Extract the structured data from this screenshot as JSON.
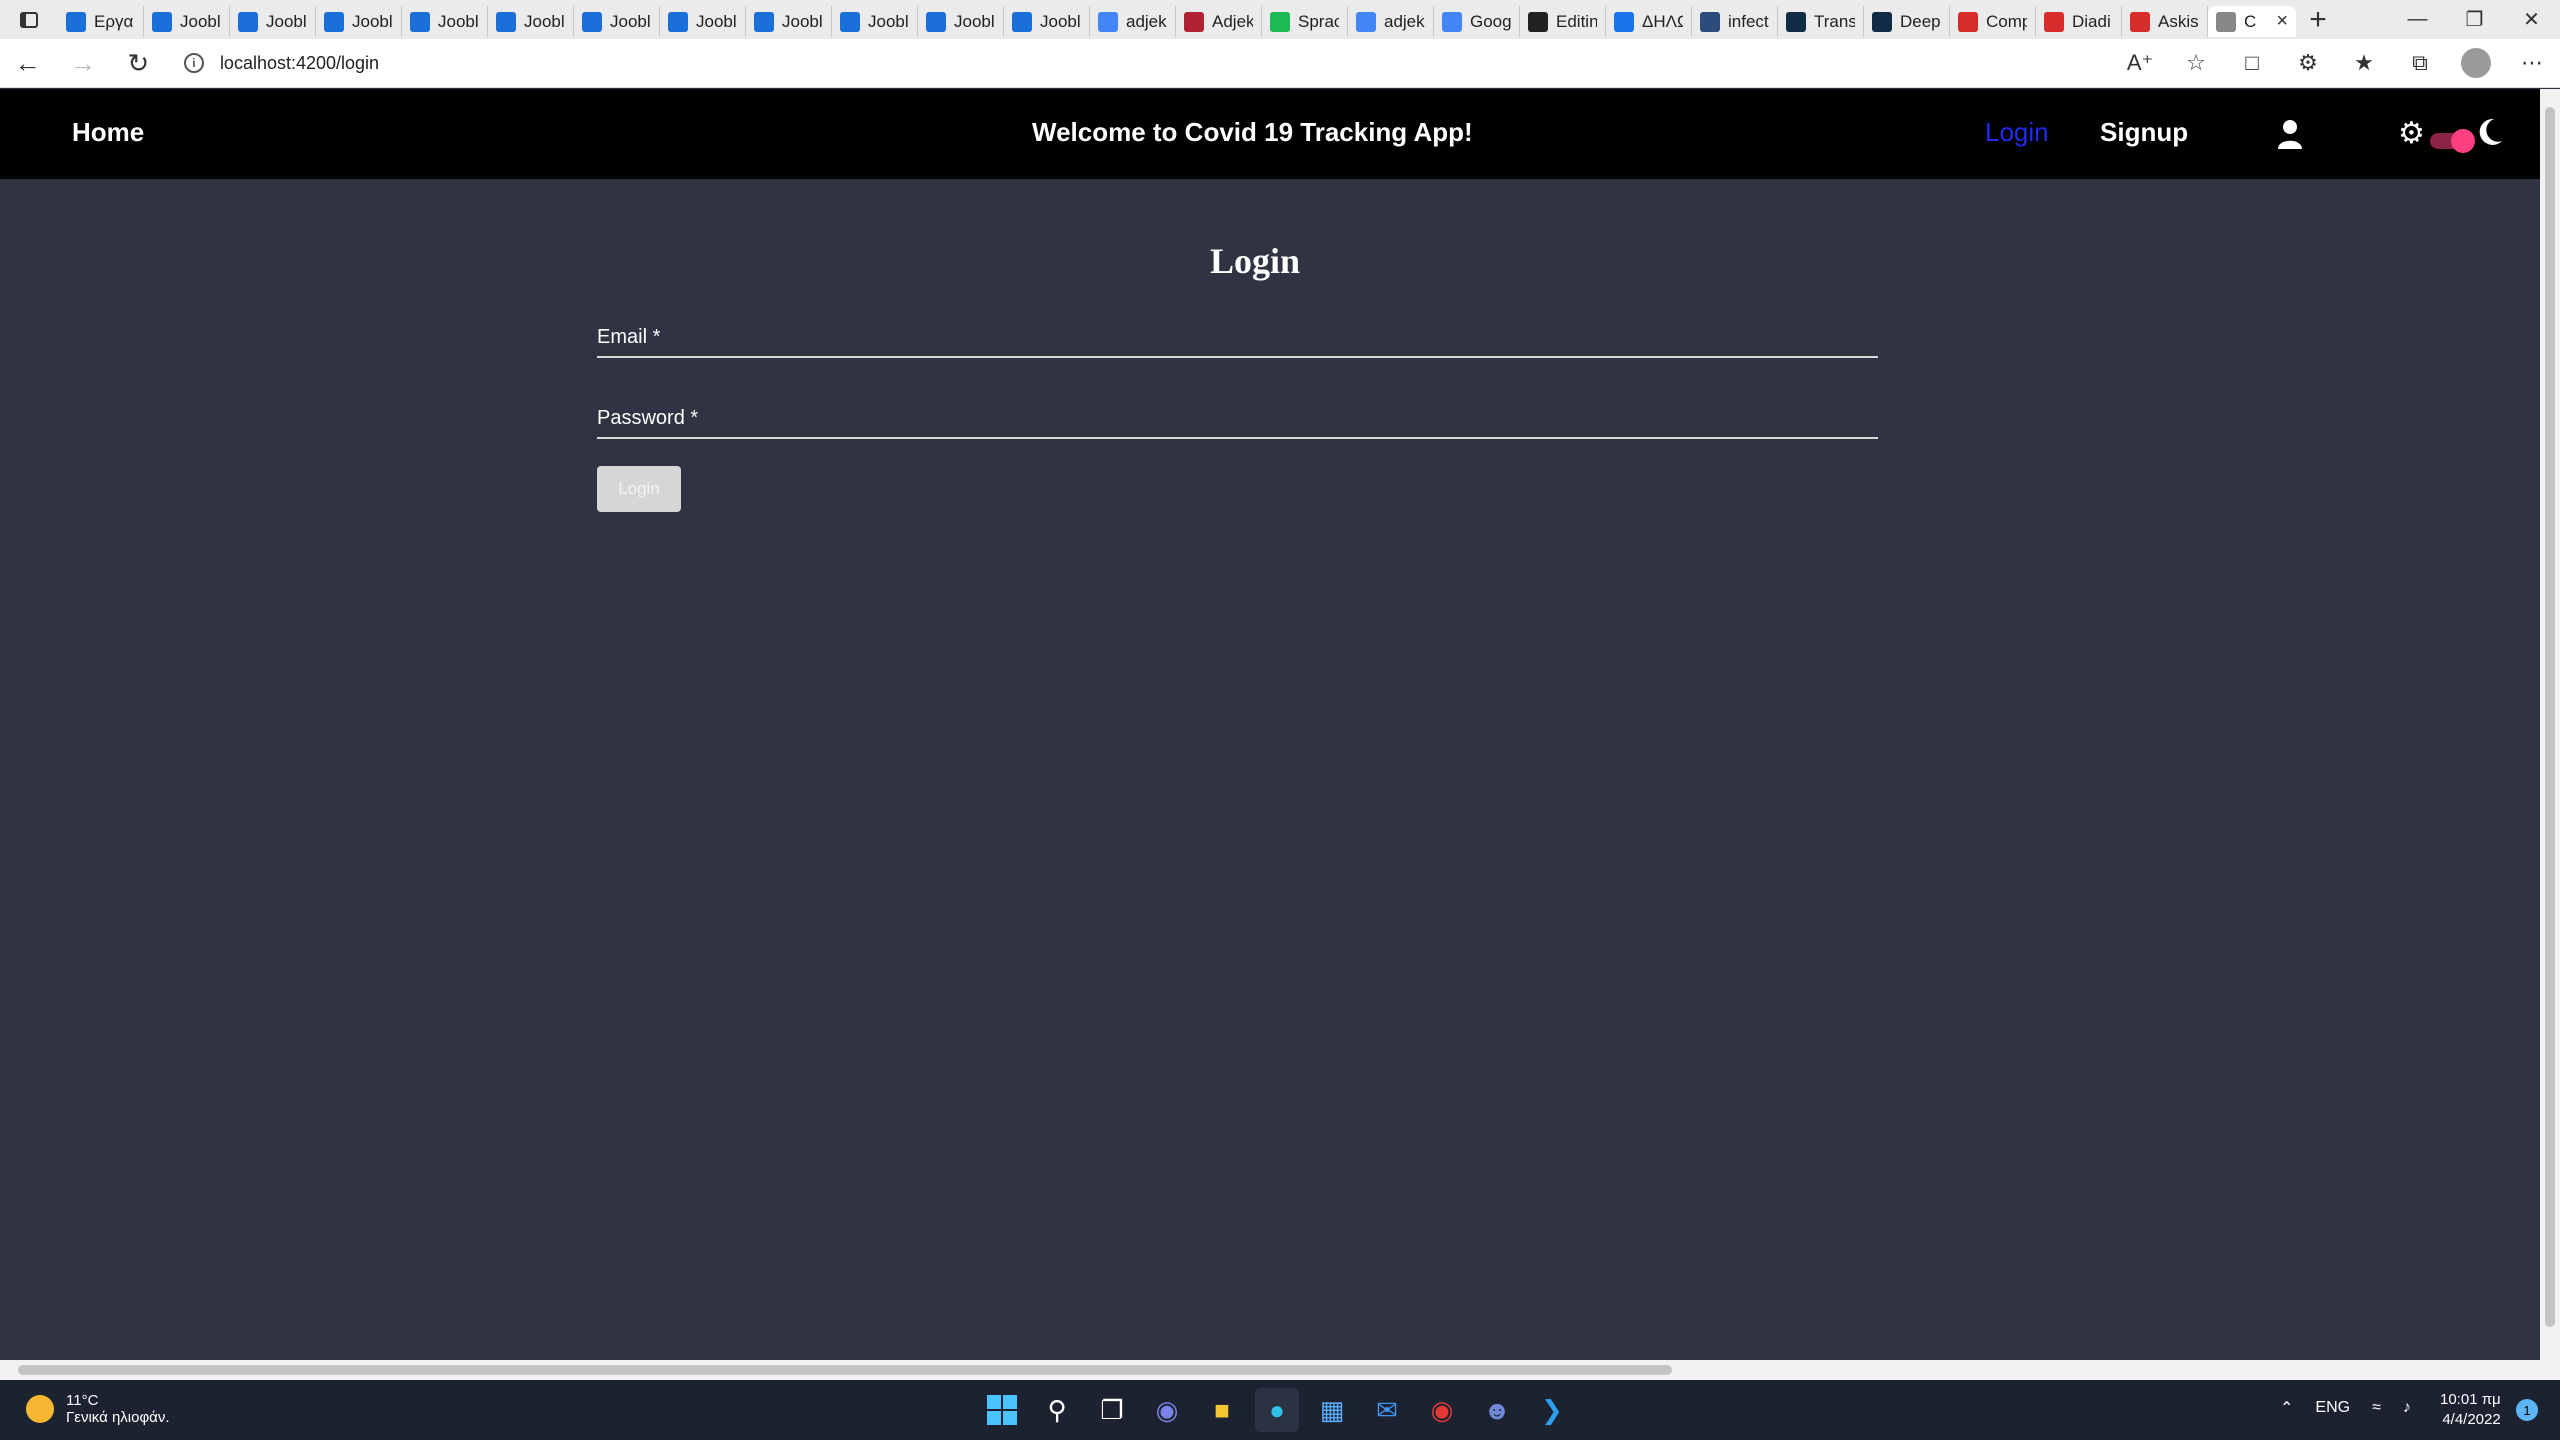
{
  "browser": {
    "tabs": [
      {
        "title": "Εργα",
        "icon": "ukraine-flag-icon",
        "color": "#1a6fd8"
      },
      {
        "title": "Jooble",
        "icon": "ukraine-flag-icon",
        "color": "#1a6fd8"
      },
      {
        "title": "Jooble",
        "icon": "ukraine-flag-icon",
        "color": "#1a6fd8"
      },
      {
        "title": "Jooble",
        "icon": "ukraine-flag-icon",
        "color": "#1a6fd8"
      },
      {
        "title": "Jooble",
        "icon": "ukraine-flag-icon",
        "color": "#1a6fd8"
      },
      {
        "title": "Jooble",
        "icon": "ukraine-flag-icon",
        "color": "#1a6fd8"
      },
      {
        "title": "Jooble",
        "icon": "ukraine-flag-icon",
        "color": "#1a6fd8"
      },
      {
        "title": "Jooble",
        "icon": "ukraine-flag-icon",
        "color": "#1a6fd8"
      },
      {
        "title": "Jooble",
        "icon": "ukraine-flag-icon",
        "color": "#1a6fd8"
      },
      {
        "title": "Jooble",
        "icon": "ukraine-flag-icon",
        "color": "#1a6fd8"
      },
      {
        "title": "Jooble",
        "icon": "ukraine-flag-icon",
        "color": "#1a6fd8"
      },
      {
        "title": "Jooble",
        "icon": "ukraine-flag-icon",
        "color": "#1a6fd8"
      },
      {
        "title": "adjek",
        "icon": "google-icon",
        "color": "#4285f4"
      },
      {
        "title": "Adjek",
        "icon": "flag-icon",
        "color": "#b22234"
      },
      {
        "title": "Sprac",
        "icon": "green-dot-icon",
        "color": "#1db954"
      },
      {
        "title": "adjek",
        "icon": "google-icon",
        "color": "#4285f4"
      },
      {
        "title": "Goog",
        "icon": "google-icon",
        "color": "#4285f4"
      },
      {
        "title": "Editin",
        "icon": "github-icon",
        "color": "#222222"
      },
      {
        "title": "ΔΗΛΩ",
        "icon": "chat-icon",
        "color": "#1a73e8"
      },
      {
        "title": "infect",
        "icon": "notebook-icon",
        "color": "#2d4c7c"
      },
      {
        "title": "Transl",
        "icon": "deepl-icon",
        "color": "#0f2b46"
      },
      {
        "title": "Deepl",
        "icon": "deepl-icon",
        "color": "#0f2b46"
      },
      {
        "title": "Comp",
        "icon": "pdf-icon",
        "color": "#d62c2c"
      },
      {
        "title": "Diadi",
        "icon": "pdf-icon",
        "color": "#d62c2c"
      },
      {
        "title": "Askis",
        "icon": "pdf-icon",
        "color": "#d62c2c"
      },
      {
        "title": "C",
        "icon": "app-icon",
        "color": "#888888"
      }
    ],
    "url": "localhost:4200/login"
  },
  "nav": {
    "home": "Home",
    "welcome": "Welcome to Covid 19 Tracking App!",
    "login": "Login",
    "signup": "Signup",
    "login_color": "#1f2bf2"
  },
  "form": {
    "title": "Login",
    "email_label": "Email *",
    "password_label": "Password *",
    "submit": "Login"
  },
  "taskbar": {
    "temperature": "11°C",
    "weather_desc": "Γενικά ηλιοφάν.",
    "lang": "ENG",
    "time": "10:01 πμ",
    "date": "4/4/2022",
    "notifications": "1"
  }
}
